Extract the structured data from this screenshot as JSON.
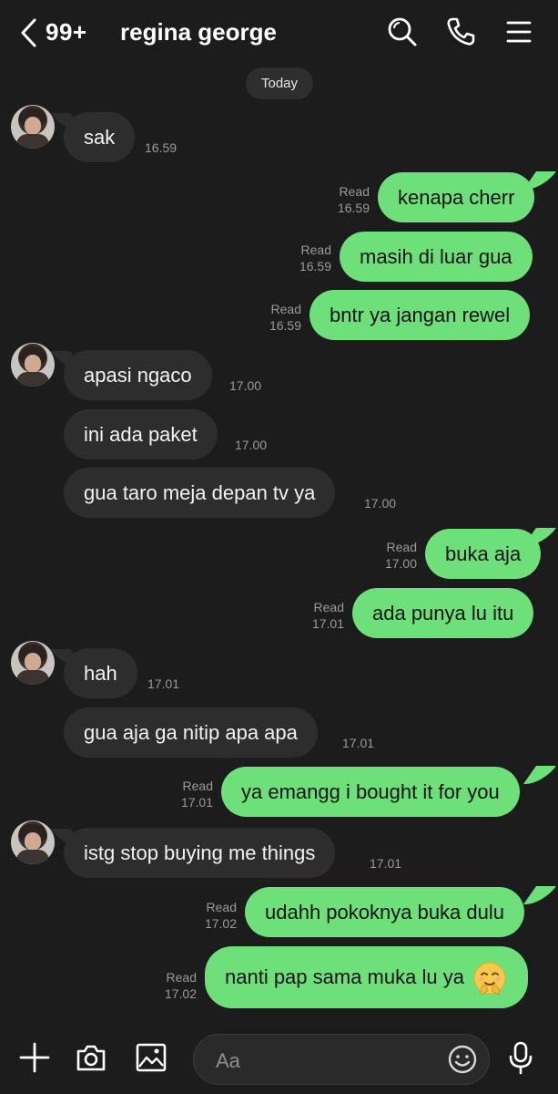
{
  "header": {
    "unread_count": "99+",
    "contact_name": "regina george",
    "icons": [
      "back-chevron-icon",
      "search-icon",
      "phone-icon",
      "menu-icon"
    ]
  },
  "date_divider": "Today",
  "messages": [
    {
      "dir": "in",
      "text": "sak",
      "time": "16.59"
    },
    {
      "dir": "out",
      "text": "kenapa cherr",
      "read": "Read",
      "time": "16.59"
    },
    {
      "dir": "out",
      "text": "masih di luar gua",
      "read": "Read",
      "time": "16.59"
    },
    {
      "dir": "out",
      "text": "bntr ya jangan rewel",
      "read": "Read",
      "time": "16.59"
    },
    {
      "dir": "in",
      "text": "apasi ngaco",
      "time": "17.00"
    },
    {
      "dir": "in",
      "text": "ini ada paket",
      "time": "17.00"
    },
    {
      "dir": "in",
      "text": "gua taro meja depan tv ya",
      "time": "17.00"
    },
    {
      "dir": "out",
      "text": "buka aja",
      "read": "Read",
      "time": "17.00"
    },
    {
      "dir": "out",
      "text": "ada punya lu itu",
      "read": "Read",
      "time": "17.01"
    },
    {
      "dir": "in",
      "text": "hah",
      "time": "17.01"
    },
    {
      "dir": "in",
      "text": "gua aja ga nitip apa apa",
      "time": "17.01"
    },
    {
      "dir": "out",
      "text": "ya emangg i bought it for you",
      "read": "Read",
      "time": "17.01"
    },
    {
      "dir": "in",
      "text": "istg stop buying me things",
      "time": "17.01"
    },
    {
      "dir": "out",
      "text": "udahh pokoknya buka dulu",
      "read": "Read",
      "time": "17.02"
    },
    {
      "dir": "out",
      "text": "nanti pap sama muka lu ya",
      "read": "Read",
      "time": "17.02",
      "emoji": "hugging-face-emoji"
    }
  ],
  "composer": {
    "placeholder": "Aa",
    "icons": [
      "plus-icon",
      "camera-icon",
      "image-icon",
      "emoji-icon",
      "microphone-icon"
    ]
  },
  "colors": {
    "background": "#1c1c1d",
    "incoming_bubble": "#2d2d2e",
    "outgoing_bubble": "#6de07a",
    "meta_text": "#9a9a9a"
  }
}
